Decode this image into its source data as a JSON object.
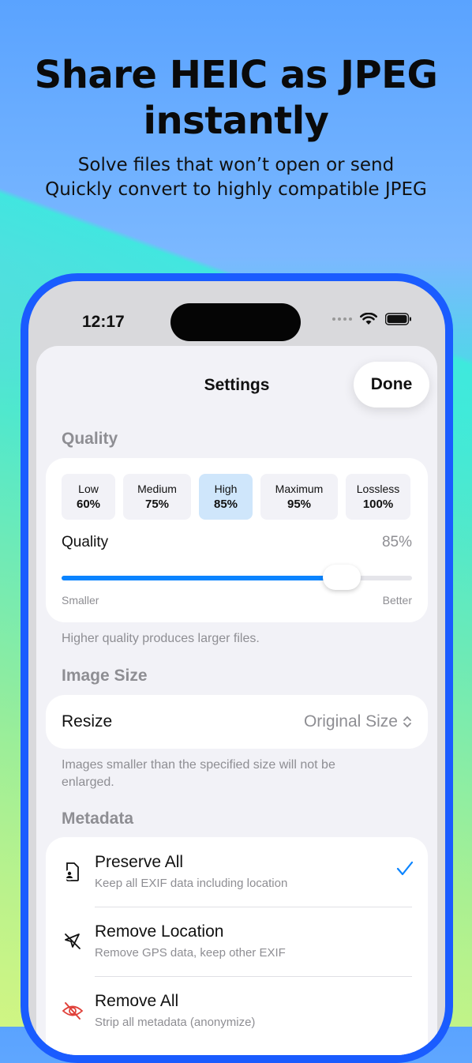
{
  "hero": {
    "title_line1": "Share HEIC as JPEG",
    "title_line2": "instantly",
    "subtitle_line1": "Solve files that won’t open or send",
    "subtitle_line2": "Quickly convert to highly compatible JPEG"
  },
  "status_bar": {
    "time": "12:17"
  },
  "settings": {
    "title": "Settings",
    "done_label": "Done",
    "quality": {
      "section_label": "Quality",
      "presets": [
        {
          "name": "Low",
          "value": "60%"
        },
        {
          "name": "Medium",
          "value": "75%"
        },
        {
          "name": "High",
          "value": "85%"
        },
        {
          "name": "Maximum",
          "value": "95%"
        },
        {
          "name": "Lossless",
          "value": "100%"
        }
      ],
      "selected_preset": "High",
      "slider_label": "Quality",
      "slider_value_text": "85%",
      "slider_fraction": 0.8,
      "slider_min_label": "Smaller",
      "slider_max_label": "Better",
      "footnote": "Higher quality produces larger files."
    },
    "image_size": {
      "section_label": "Image Size",
      "resize_label": "Resize",
      "resize_value": "Original Size",
      "footnote": "Images smaller than the specified size will not be enlarged."
    },
    "metadata": {
      "section_label": "Metadata",
      "options": [
        {
          "title": "Preserve All",
          "desc": "Keep all EXIF data including location",
          "icon": "document-person-icon",
          "checked": true
        },
        {
          "title": "Remove Location",
          "desc": "Remove GPS data, keep other EXIF",
          "icon": "location-slash-icon",
          "checked": false
        },
        {
          "title": "Remove All",
          "desc": "Strip all metadata (anonymize)",
          "icon": "eye-slash-icon",
          "checked": false
        }
      ]
    }
  },
  "colors": {
    "accent": "#0a84ff",
    "selected_preset_bg": "#cfe6fb",
    "phone_frame": "#1a5cff",
    "remove_all_icon": "#e0413a"
  }
}
